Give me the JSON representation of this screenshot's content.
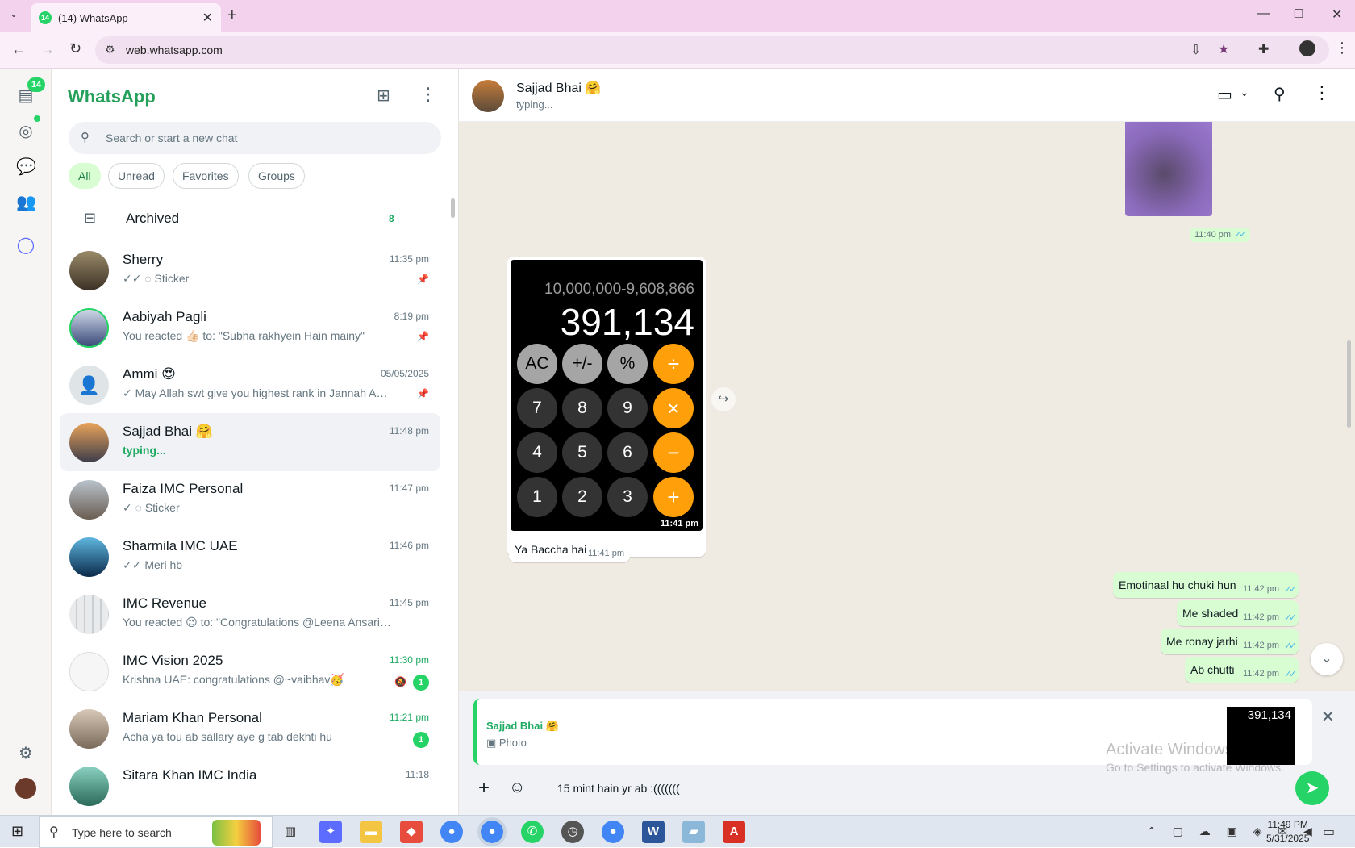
{
  "browser": {
    "tab_title": "(14) WhatsApp",
    "tab_badge": "14",
    "url": "web.whatsapp.com"
  },
  "rail": {
    "unread_badge": "14"
  },
  "sidebar": {
    "brand": "WhatsApp",
    "search_placeholder": "Search or start a new chat",
    "filters": [
      "All",
      "Unread",
      "Favorites",
      "Groups"
    ],
    "archived": {
      "label": "Archived",
      "count": "8"
    },
    "chats": [
      {
        "name": "Sherry",
        "preview": "✓✓ ◌ Sticker",
        "time": "11:35 pm",
        "pinned": true
      },
      {
        "name": "Aabiyah Pagli",
        "preview": "You reacted 👍🏻 to: \"Subha rakhyein Hain mainy\"",
        "time": "8:19 pm",
        "pinned": true
      },
      {
        "name": "Ammi 😍",
        "preview": "✓ May Allah swt give you highest rank in Jannah  Ame...",
        "time": "05/05/2025",
        "pinned": true
      },
      {
        "name": "Sajjad Bhai 🤗",
        "preview": "typing...",
        "time": "11:48 pm"
      },
      {
        "name": "Faiza IMC Personal",
        "preview": "✓ ◌ Sticker",
        "time": "11:47 pm"
      },
      {
        "name": "Sharmila IMC UAE",
        "preview": "✓✓ Meri hb",
        "time": "11:46 pm"
      },
      {
        "name": "IMC Revenue",
        "preview": "You reacted 😍 to: \"Congratulations @Leena Ansari impre...",
        "time": "11:45 pm"
      },
      {
        "name": "IMC Vision 2025",
        "preview": "Krishna UAE: congratulations @~vaibhav🥳",
        "time": "11:30 pm",
        "unread": "1"
      },
      {
        "name": "Mariam Khan Personal",
        "preview": "Acha ya tou ab sallary aye g tab dekhti hu",
        "time": "11:21 pm",
        "unread": "1"
      },
      {
        "name": "Sitara Khan IMC India",
        "preview": "",
        "time": "11:18"
      }
    ]
  },
  "conversation": {
    "contact_name": "Sajjad Bhai 🤗",
    "status": "typing...",
    "photo_time": "11:40 pm",
    "calculator": {
      "expression": "10,000,000-9,608,866",
      "result": "391,134",
      "keys": [
        "AC",
        "+/-",
        "%",
        "÷",
        "7",
        "8",
        "9",
        "×",
        "4",
        "5",
        "6",
        "−",
        "1",
        "2",
        "3",
        "+"
      ],
      "timestamp": "11:41 pm"
    },
    "messages": [
      {
        "text": "Ya Baccha hai",
        "time": "11:41 pm",
        "direction": "in"
      },
      {
        "text": "Emotinaal hu chuki hun",
        "time": "11:42 pm",
        "direction": "out"
      },
      {
        "text": "Me shaded",
        "time": "11:42 pm",
        "direction": "out"
      },
      {
        "text": "Me ronay jarhi",
        "time": "11:42 pm",
        "direction": "out"
      },
      {
        "text": "Ab chutti",
        "time": "11:42 pm",
        "direction": "out"
      }
    ],
    "reply": {
      "name": "Sajjad Bhai 🤗",
      "label": "Photo",
      "thumb_value": "391,134"
    },
    "composer_text": "15 mint hain yr ab :(((((((",
    "watermark_title": "Activate Windows",
    "watermark_sub": "Go to Settings to activate Windows."
  },
  "taskbar": {
    "search_placeholder": "Type here to search",
    "time": "11:49 PM",
    "date": "5/31/2025"
  },
  "colors": {
    "accent": "#25d366",
    "outgoing_bubble": "#d9fdd3",
    "chat_bg": "#efeae2"
  }
}
